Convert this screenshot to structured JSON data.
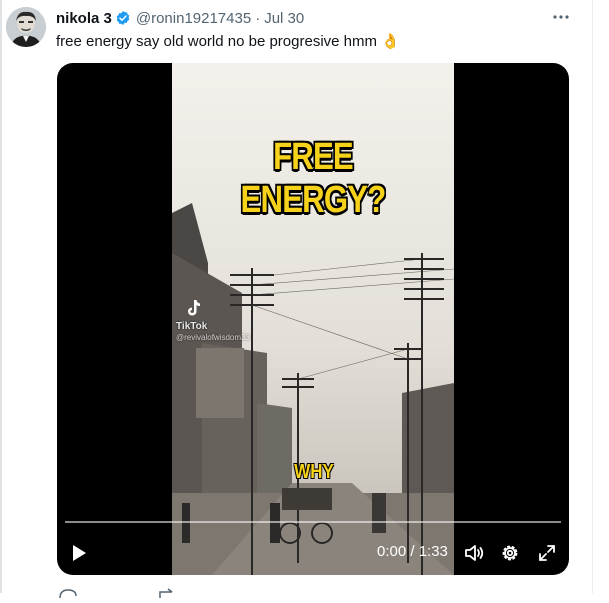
{
  "tweet": {
    "author_name": "nikola 3",
    "handle": "@ronin19217435",
    "separator": "·",
    "date": "Jul 30",
    "text": "free energy say old world no be progresive hmm 👌"
  },
  "media": {
    "caption_top": "FREE ENERGY?",
    "caption_bottom": "WHY",
    "watermark_brand": "TikTok",
    "watermark_user": "@revivalofwisdom33",
    "time_display": "0:00 / 1:33",
    "progress_fraction": 0.0
  },
  "icons": {
    "verified": "verified-badge-icon",
    "more": "more-icon",
    "play": "play-icon",
    "volume": "volume-icon",
    "settings": "settings-icon",
    "fullscreen": "fullscreen-icon"
  },
  "colors": {
    "verified_blue": "#1d9bf0",
    "caption_yellow": "#f6d21b",
    "secondary_text": "#536471"
  }
}
